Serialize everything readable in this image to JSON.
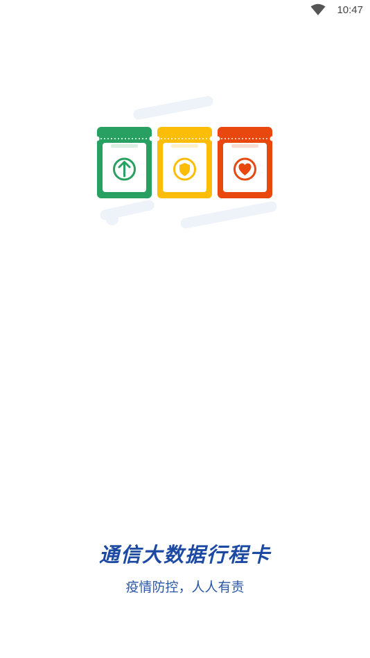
{
  "status_bar": {
    "time": "10:47",
    "wifi_icon": "wifi-icon"
  },
  "hero": {
    "cards": [
      {
        "color": "#27a061",
        "icon": "arrow-up-icon"
      },
      {
        "color": "#fbbd07",
        "icon": "shield-icon"
      },
      {
        "color": "#e8470d",
        "icon": "heart-icon"
      }
    ],
    "backdrop_color": "#eef3fa"
  },
  "app": {
    "title": "通信大数据行程卡",
    "slogan": "疫情防控，人人有责",
    "brand_color": "#1c4aa3"
  }
}
